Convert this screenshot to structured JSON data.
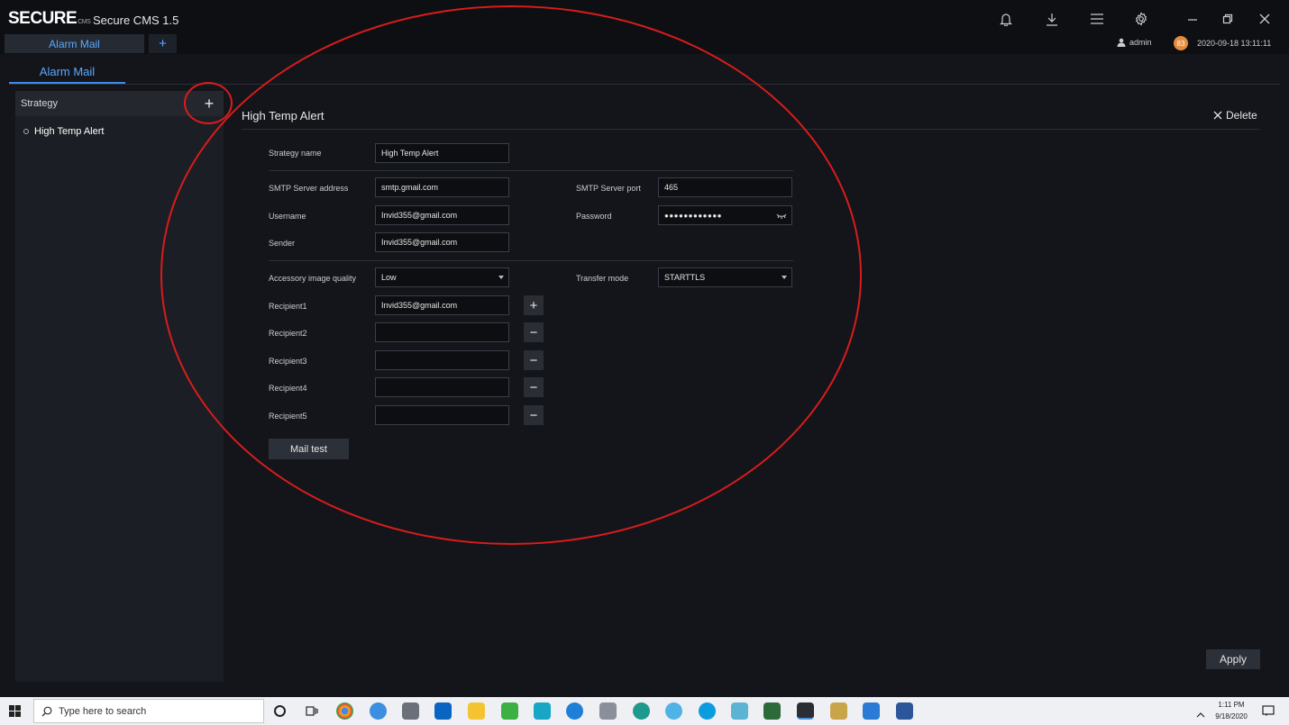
{
  "window": {
    "logo_text": "SECURE",
    "logo_sub": "CMS",
    "title": "Secure CMS 1.5",
    "icons": [
      "bell-icon",
      "download-icon",
      "menu-icon",
      "gear-icon",
      "minimize-icon",
      "restore-icon",
      "close-icon"
    ]
  },
  "tabs": {
    "app_tab": "Alarm Mail",
    "add_tab": "+"
  },
  "status": {
    "user": "admin",
    "badge": "83",
    "datetime": "2020-09-18 13:11:11"
  },
  "page_tab": "Alarm Mail",
  "sidebar": {
    "header": "Strategy",
    "add": "+",
    "items": [
      {
        "label": "High Temp Alert"
      }
    ]
  },
  "detail": {
    "title": "High Temp Alert",
    "delete_label": "Delete"
  },
  "form": {
    "strategy_name": {
      "label": "Strategy name",
      "value": "High Temp Alert"
    },
    "smtp_address": {
      "label": "SMTP Server address",
      "value": "smtp.gmail.com"
    },
    "smtp_port": {
      "label": "SMTP Server port",
      "value": "465"
    },
    "username": {
      "label": "Username",
      "value": "Invid355@gmail.com"
    },
    "password": {
      "label": "Password",
      "value": "●●●●●●●●●●●●"
    },
    "sender": {
      "label": "Sender",
      "value": "Invid355@gmail.com"
    },
    "image_quality": {
      "label": "Accessory image quality",
      "value": "Low"
    },
    "transfer_mode": {
      "label": "Transfer mode",
      "value": "STARTTLS"
    },
    "recipients": [
      {
        "label": "Recipient1",
        "value": "Invid355@gmail.com",
        "action": "+"
      },
      {
        "label": "Recipient2",
        "value": "",
        "action": "−"
      },
      {
        "label": "Recipient3",
        "value": "",
        "action": "−"
      },
      {
        "label": "Recipient4",
        "value": "",
        "action": "−"
      },
      {
        "label": "Recipient5",
        "value": "",
        "action": "−"
      }
    ],
    "mail_test_label": "Mail test",
    "apply_label": "Apply"
  },
  "annotation_color": "#d91c1c",
  "taskbar": {
    "search_placeholder": "Type here to search",
    "time": "1:11 PM",
    "date": "9/18/2020"
  },
  "colors": {
    "accent": "#3d8de8",
    "background": "#13151a",
    "taskbar": "#eef0f3"
  }
}
